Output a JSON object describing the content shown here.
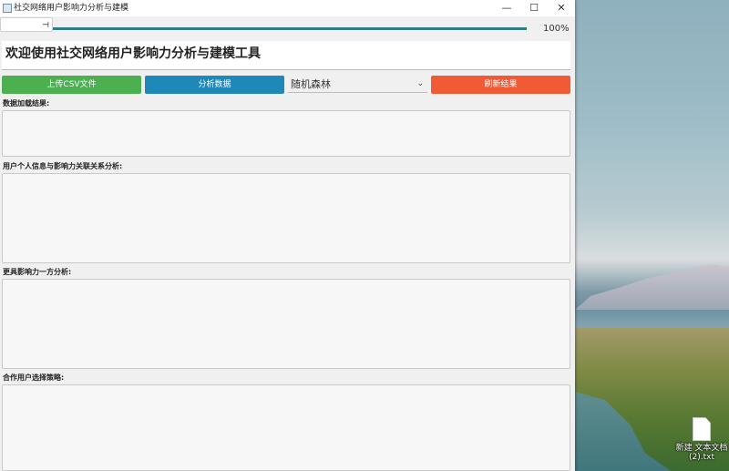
{
  "window": {
    "title": "社交网络用户影响力分析与建模",
    "controls": {
      "minimize": "—",
      "maximize": "☐",
      "close": "✕"
    }
  },
  "progress": {
    "value_percent": 100,
    "label": "100%",
    "handle_text": "⊣"
  },
  "welcome": {
    "text": "欢迎使用社交网络用户影响力分析与建模工具"
  },
  "toolbar": {
    "upload_label": "上传CSV文件",
    "analyze_label": "分析数据",
    "model_select": {
      "selected": "随机森林"
    },
    "refresh_label": "刷新结果"
  },
  "sections": [
    {
      "label": "数据加载结果:",
      "content": ""
    },
    {
      "label": "用户个人信息与影响力关联关系分析:",
      "content": ""
    },
    {
      "label": "更具影响力一方分析:",
      "content": ""
    },
    {
      "label": "合作用户选择策略:",
      "content": ""
    }
  ],
  "desktop": {
    "file_name": "新建 文本文档 (2).txt"
  },
  "colors": {
    "upload": "#4caf50",
    "analyze": "#1e88b8",
    "refresh": "#f05a35",
    "progress": "#2f7d8c"
  }
}
